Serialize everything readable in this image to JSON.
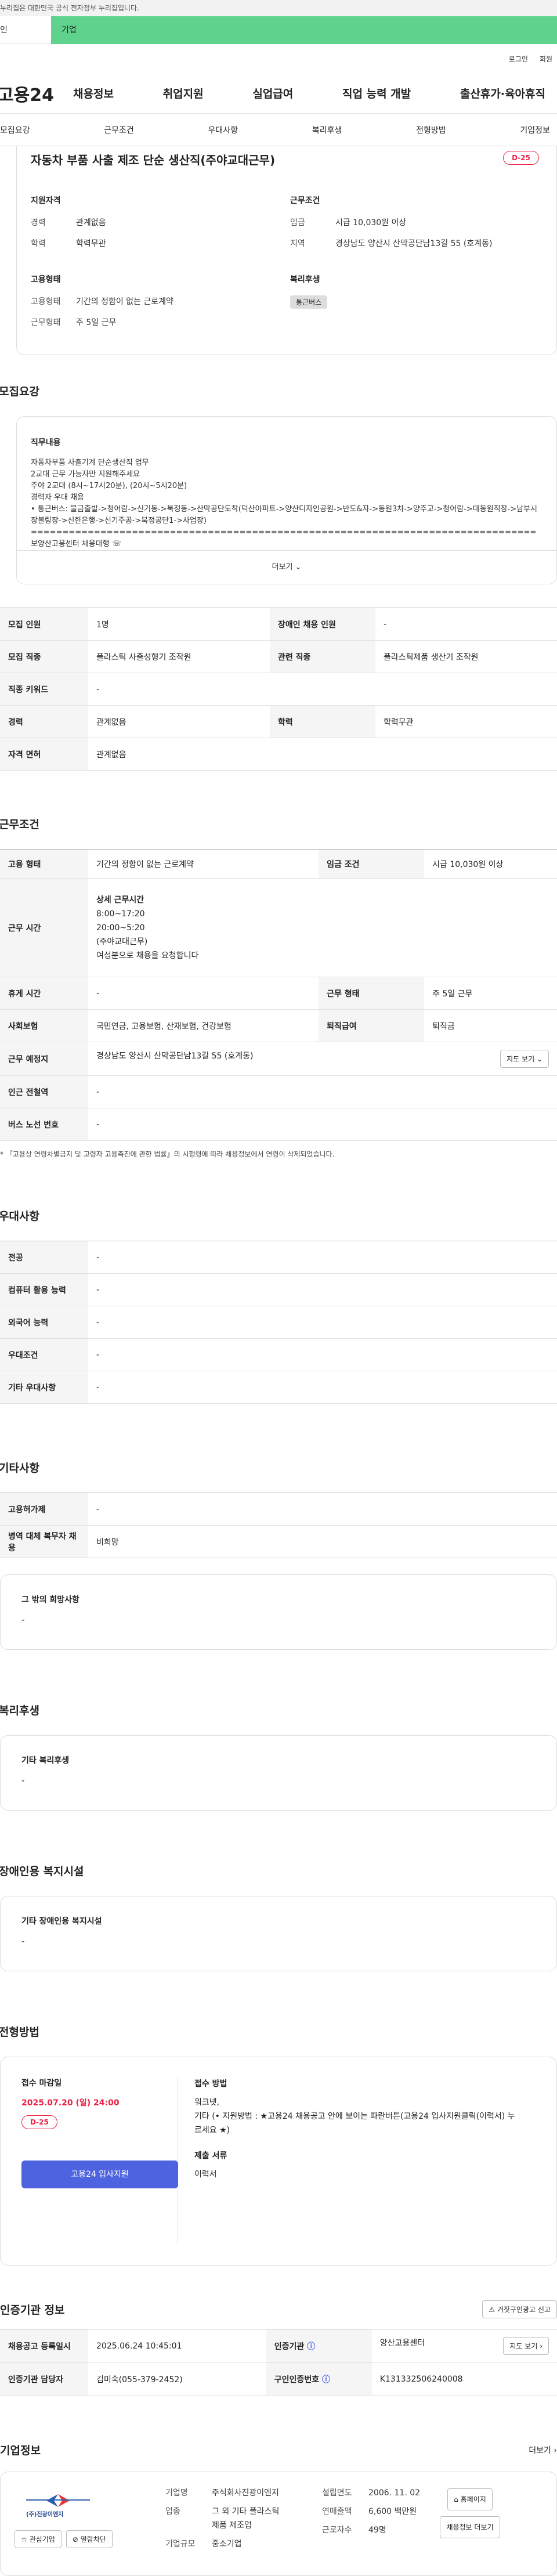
{
  "top": {
    "gov_notice": "누리집은 대한민국 공식 전자정부 누리집입니다.",
    "tab_personal": "인",
    "tab_company": "기업",
    "login": "로그인",
    "join": "회원"
  },
  "gnb": {
    "logo": "고용24",
    "menu": [
      "채용정보",
      "취업지원",
      "실업급여",
      "직업 능력 개발",
      "출산휴가·육아휴직"
    ]
  },
  "subnav": [
    "모집요강",
    "근무조건",
    "우대사항",
    "복리후생",
    "전형방법",
    "기업정보"
  ],
  "title": {
    "text": "자동차 부품 사출 제조 단순 생산직(주야교대근무)",
    "dday": "D-25"
  },
  "summary": {
    "req_label": "지원자격",
    "exp_k": "경력",
    "exp_v": "관계없음",
    "edu_k": "학력",
    "edu_v": "학력무관",
    "cond_label": "근무조건",
    "wage_k": "임금",
    "wage_v": "시급 10,030원 이상",
    "region_k": "지역",
    "region_v": "경상남도 양산시 산막공단남13길 55 (호계동)",
    "emp_label": "고용형태",
    "emptype_k": "고용형태",
    "emptype_v": "기간의 정함이 없는 근로계약",
    "work_k": "근무형태",
    "work_v": "주 5일 근무",
    "welfare_label": "복리후생",
    "welfare_chip": "통근버스"
  },
  "recruit": {
    "heading": "모집요강",
    "job_head": "직무내용",
    "job_text": "자동차부품 사출기계 단순생산직 업무\n2교대 근무 가능자만 지원해주세요\n주야 2교대 (8시~17시20분), (20시~5시20분)\n경력자 우대 채용\n• 통근버스: 물금출발->청어람->신기동->북정동->산막공단도착(덕산아파트->양산디자인공원->반도&자->동원3차->양주교->청어람->대동원직장->남부시장볼링장->신한은행->신기주공->북정공단1->사업장)\n================================================================================\n보양산고용센터 채용대행 ☏\n• * 직무내용, 근무시간, 급여 등* 확인 후 지원부탁드립니다.",
    "more": "더보기",
    "rows": [
      [
        "모집 인원",
        "1명",
        "장애인 채용 인원",
        "-"
      ],
      [
        "모집 직종",
        "플라스틱 사출성형기 조작원",
        "관련 직종",
        "플라스틱제품 생산기 조작원"
      ],
      [
        "직종 키워드",
        "-",
        "",
        ""
      ],
      [
        "경력",
        "관계없음",
        "학력",
        "학력무관"
      ],
      [
        "자격 면허",
        "관계없음",
        "",
        ""
      ]
    ]
  },
  "conditions": {
    "heading": "근무조건",
    "r1": [
      "고용 형태",
      "기간의 정함이 없는 근로계약",
      "임금 조건",
      "시급 10,030원 이상"
    ],
    "hours_k": "근무 시간",
    "hours_head": "상세 근무시간",
    "hours_lines": [
      "8:00~17:20",
      "20:00~5:20",
      "(주야교대근무)",
      "여성분으로 채용을 요청합니다"
    ],
    "r3": [
      "휴게 시간",
      "-",
      "근무 형태",
      "주 5일 근무"
    ],
    "r4": [
      "사회보험",
      "국민연금, 고용보험, 산재보험, 건강보험",
      "퇴직급여",
      "퇴직금"
    ],
    "place_k": "근무 예정지",
    "place_v": "경상남도 양산시 산막공단남13길 55 (호계동)",
    "map_btn": "지도 보기",
    "r6": [
      "인근 전철역",
      "-"
    ],
    "r7": [
      "버스 노선 번호",
      "-"
    ],
    "note": "* 『고용상 연령차별금지 및 고령자 고용촉진에 관한 법률』의 시행령에 따라 채용정보에서 연령이 삭제되었습니다."
  },
  "pref": {
    "heading": "우대사항",
    "rows": [
      [
        "전공",
        "-"
      ],
      [
        "컴퓨터 활용 능력",
        "-"
      ],
      [
        "외국어 능력",
        "-"
      ],
      [
        "우대조건",
        "-"
      ],
      [
        "기타 우대사항",
        "-"
      ]
    ]
  },
  "etc": {
    "heading": "기타사항",
    "rows": [
      [
        "고용허가제",
        "-"
      ],
      [
        "병역 대체 복무자 채용",
        "비희망"
      ]
    ],
    "box_title": "그 밖의 희망사항",
    "box_val": "-"
  },
  "welfare": {
    "heading": "복리후생",
    "box_title": "기타 복리후생",
    "box_val": "-"
  },
  "disab": {
    "heading": "장애인용 복지시설",
    "box_title": "기타 장애인용 복지시설",
    "box_val": "-"
  },
  "apply": {
    "heading": "전형방법",
    "deadline_label": "접수 마감일",
    "deadline": "2025.07.20 (일) 24:00",
    "dday": "D-25",
    "method_label": "접수 방법",
    "method_lines": [
      "워크넷,",
      "기타 (• 지원방법 : ★고용24 채용공고 안에 보이는 파란버튼(고용24 입사지원클릭(이력서) 누",
      "르세요 ★)"
    ],
    "docs_label": "제출 서류",
    "docs_val": "이력서",
    "button": "고용24 입사지원"
  },
  "cert": {
    "heading": "인증기관 정보",
    "report_btn": "거짓구인광고 신고",
    "r1": [
      "채용공고 등록일시",
      "2025.06.24 10:45:01",
      "인증기관",
      "양산고용센터"
    ],
    "map_btn": "지도 보기",
    "r2": [
      "인증기관 담당자",
      "김미숙(055-379-2452)",
      "구인인증번호",
      "K131332506240008"
    ]
  },
  "company": {
    "heading": "기업정보",
    "more": "더보기",
    "logo_text": "(주)진광이엔지",
    "fav": "관심기업",
    "block": "열람차단",
    "name_k": "기업명",
    "name_v": "주식회사진광이엔지",
    "ind_k": "업종",
    "ind_v": "그 외 기타 플라스틱 제품 제조업",
    "size_k": "기업규모",
    "size_v": "중소기업",
    "est_k": "설립연도",
    "est_v": "2006. 11. 02",
    "sales_k": "연매출액",
    "sales_v": "6,600 백만원",
    "emp_k": "근로자수",
    "emp_v": "49명",
    "home_btn": "홈페이지",
    "jobs_btn": "채용정보 더보기"
  },
  "colors": {
    "accent": "#4d63e0",
    "green": "#5fd38d",
    "red": "#e24"
  }
}
